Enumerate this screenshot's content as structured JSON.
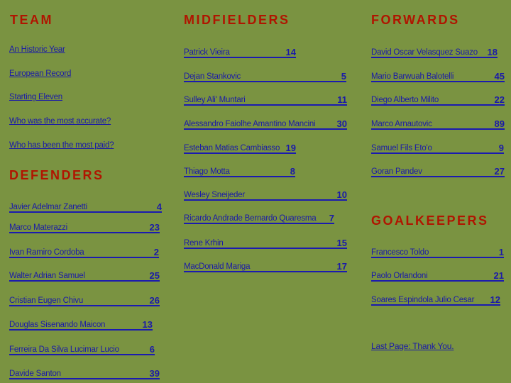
{
  "colors": {
    "background": "#7a9341",
    "heading": "#b01500",
    "link": "#1a1aa8"
  },
  "team": {
    "title": "TEAM",
    "links": [
      "An Historic Year",
      "European Record",
      "Starting Eleven",
      "Who was the most accurate?",
      "Who has been the most paid?"
    ]
  },
  "defenders": {
    "title": "DEFENDERS",
    "players": [
      {
        "name": "Javier Adelmar Zanetti",
        "number": "4"
      },
      {
        "name": "Marco Materazzi",
        "number": "23"
      },
      {
        "name": "Ivan Ramiro Cordoba",
        "number": "2"
      },
      {
        "name": "Walter Adrian Samuel",
        "number": "25"
      },
      {
        "name": "Cristian Eugen Chivu",
        "number": "26"
      },
      {
        "name": "Douglas Sisenando Maicon",
        "number": "13"
      },
      {
        "name": "Ferreira Da Silva Lucimar Lucio",
        "number": "6"
      },
      {
        "name": "Davide Santon",
        "number": "39"
      }
    ]
  },
  "midfielders": {
    "title": "MIDFIELDERS",
    "players": [
      {
        "name": "Patrick Vieira",
        "number": "14"
      },
      {
        "name": "Dejan Stankovic",
        "number": "5"
      },
      {
        "name": "Sulley Ali' Muntari",
        "number": "11"
      },
      {
        "name": "Alessandro Faiolhe Amantino Mancini",
        "number": "30"
      },
      {
        "name": "Esteban Matias Cambiasso",
        "number": "19"
      },
      {
        "name": "Thiago Motta",
        "number": "8"
      },
      {
        "name": "Wesley Sneijeder",
        "number": "10"
      },
      {
        "name": "Ricardo Andrade Bernardo Quaresma",
        "number": "7"
      },
      {
        "name": "Rene Krhin",
        "number": "15"
      },
      {
        "name": "MacDonald Mariga",
        "number": "17"
      }
    ]
  },
  "forwards": {
    "title": "FORWARDS",
    "players": [
      {
        "name": "David Oscar Velasquez Suazo",
        "number": "18"
      },
      {
        "name": "Mario Barwuah Balotelli",
        "number": "45"
      },
      {
        "name": "Diego Alberto Milito",
        "number": "22"
      },
      {
        "name": "Marco Arnautovic",
        "number": "89"
      },
      {
        "name": "Samuel Fils Eto'o",
        "number": "9"
      },
      {
        "name": "Goran Pandev",
        "number": "27"
      }
    ]
  },
  "goalkeepers": {
    "title": "GOALKEEPERS",
    "players": [
      {
        "name": "Francesco Toldo",
        "number": "1"
      },
      {
        "name": "Paolo Orlandoni",
        "number": "21"
      },
      {
        "name": "Soares Espindola Julio Cesar",
        "number": "12"
      }
    ]
  },
  "footer": {
    "last_page": "Last Page: Thank You."
  }
}
